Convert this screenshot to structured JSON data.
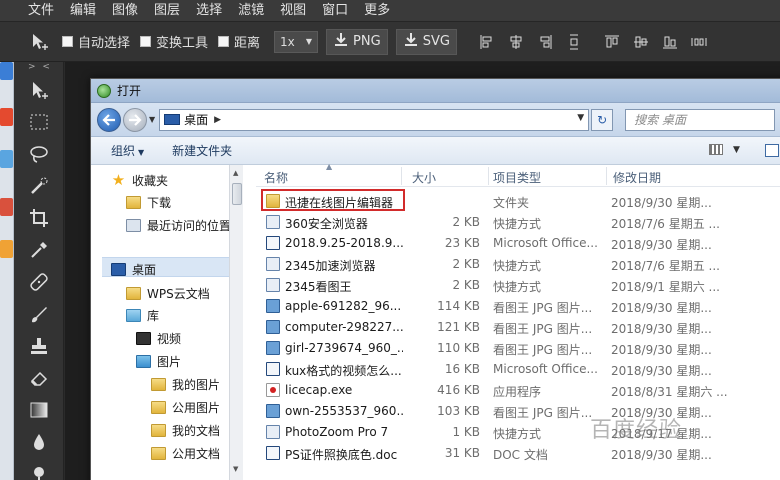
{
  "menubar": {
    "items": [
      "文件",
      "编辑",
      "图像",
      "图层",
      "选择",
      "滤镜",
      "视图",
      "窗口",
      "更多"
    ]
  },
  "toolbar": {
    "auto_select": "自动选择",
    "transform_tools": "变换工具",
    "distance": "距离",
    "zoom": "1x",
    "export_png": "PNG",
    "export_svg": "SVG"
  },
  "tools_header": "> <",
  "dialog": {
    "title": "打开",
    "address": "桌面",
    "search_placeholder": "搜索 桌面",
    "commands": {
      "organize": "组织",
      "new_folder": "新建文件夹"
    },
    "nav": [
      {
        "label": "收藏夹",
        "icon": "star"
      },
      {
        "label": "下载",
        "icon": "folder"
      },
      {
        "label": "最近访问的位置",
        "icon": "recent"
      },
      {
        "label": "桌面",
        "icon": "desktop"
      },
      {
        "label": "WPS云文档",
        "icon": "folder"
      },
      {
        "label": "库",
        "icon": "library"
      },
      {
        "label": "视频",
        "icon": "video"
      },
      {
        "label": "图片",
        "icon": "pictures"
      },
      {
        "label": "我的图片",
        "icon": "folder"
      },
      {
        "label": "公用图片",
        "icon": "folder"
      },
      {
        "label": "我的文档",
        "icon": "folder"
      },
      {
        "label": "公用文档",
        "icon": "folder"
      }
    ],
    "columns": {
      "name": "名称",
      "size": "大小",
      "type": "项目类型",
      "date": "修改日期"
    },
    "files": [
      {
        "name": "迅捷在线图片编辑器",
        "size": "",
        "type": "文件夹",
        "date": "2018/9/30 星期...",
        "icon": "folder"
      },
      {
        "name": "360安全浏览器",
        "size": "2 KB",
        "type": "快捷方式",
        "date": "2018/7/6 星期五 ...",
        "icon": "lnk"
      },
      {
        "name": "2018.9.25-2018.9....",
        "size": "23 KB",
        "type": "Microsoft Office...",
        "date": "2018/9/30 星期...",
        "icon": "doc"
      },
      {
        "name": "2345加速浏览器",
        "size": "2 KB",
        "type": "快捷方式",
        "date": "2018/7/6 星期五 ...",
        "icon": "lnk"
      },
      {
        "name": "2345看图王",
        "size": "2 KB",
        "type": "快捷方式",
        "date": "2018/9/1 星期六 ...",
        "icon": "lnk"
      },
      {
        "name": "apple-691282_96...",
        "size": "114 KB",
        "type": "看图王 JPG 图片...",
        "date": "2018/9/30 星期...",
        "icon": "jpg"
      },
      {
        "name": "computer-298227...",
        "size": "121 KB",
        "type": "看图王 JPG 图片...",
        "date": "2018/9/30 星期...",
        "icon": "jpg"
      },
      {
        "name": "girl-2739674_960_...",
        "size": "110 KB",
        "type": "看图王 JPG 图片...",
        "date": "2018/9/30 星期...",
        "icon": "jpg"
      },
      {
        "name": "kux格式的视频怎么...",
        "size": "16 KB",
        "type": "Microsoft Office...",
        "date": "2018/9/30 星期...",
        "icon": "doc"
      },
      {
        "name": "licecap.exe",
        "size": "416 KB",
        "type": "应用程序",
        "date": "2018/8/31 星期六 ...",
        "icon": "exe"
      },
      {
        "name": "own-2553537_960...",
        "size": "103 KB",
        "type": "看图王 JPG 图片...",
        "date": "2018/9/30 星期...",
        "icon": "jpg"
      },
      {
        "name": "PhotoZoom Pro 7",
        "size": "1 KB",
        "type": "快捷方式",
        "date": "2018/9/17 星期...",
        "icon": "lnk"
      },
      {
        "name": "PS证件照换底色.doc",
        "size": "31 KB",
        "type": "DOC 文档",
        "date": "2018/9/30 星期...",
        "icon": "doc"
      }
    ]
  },
  "watermark": "百度经验",
  "colors": {
    "highlight": "#d22b2b",
    "app_bg": "#333333",
    "accent": "#2a5da8"
  }
}
